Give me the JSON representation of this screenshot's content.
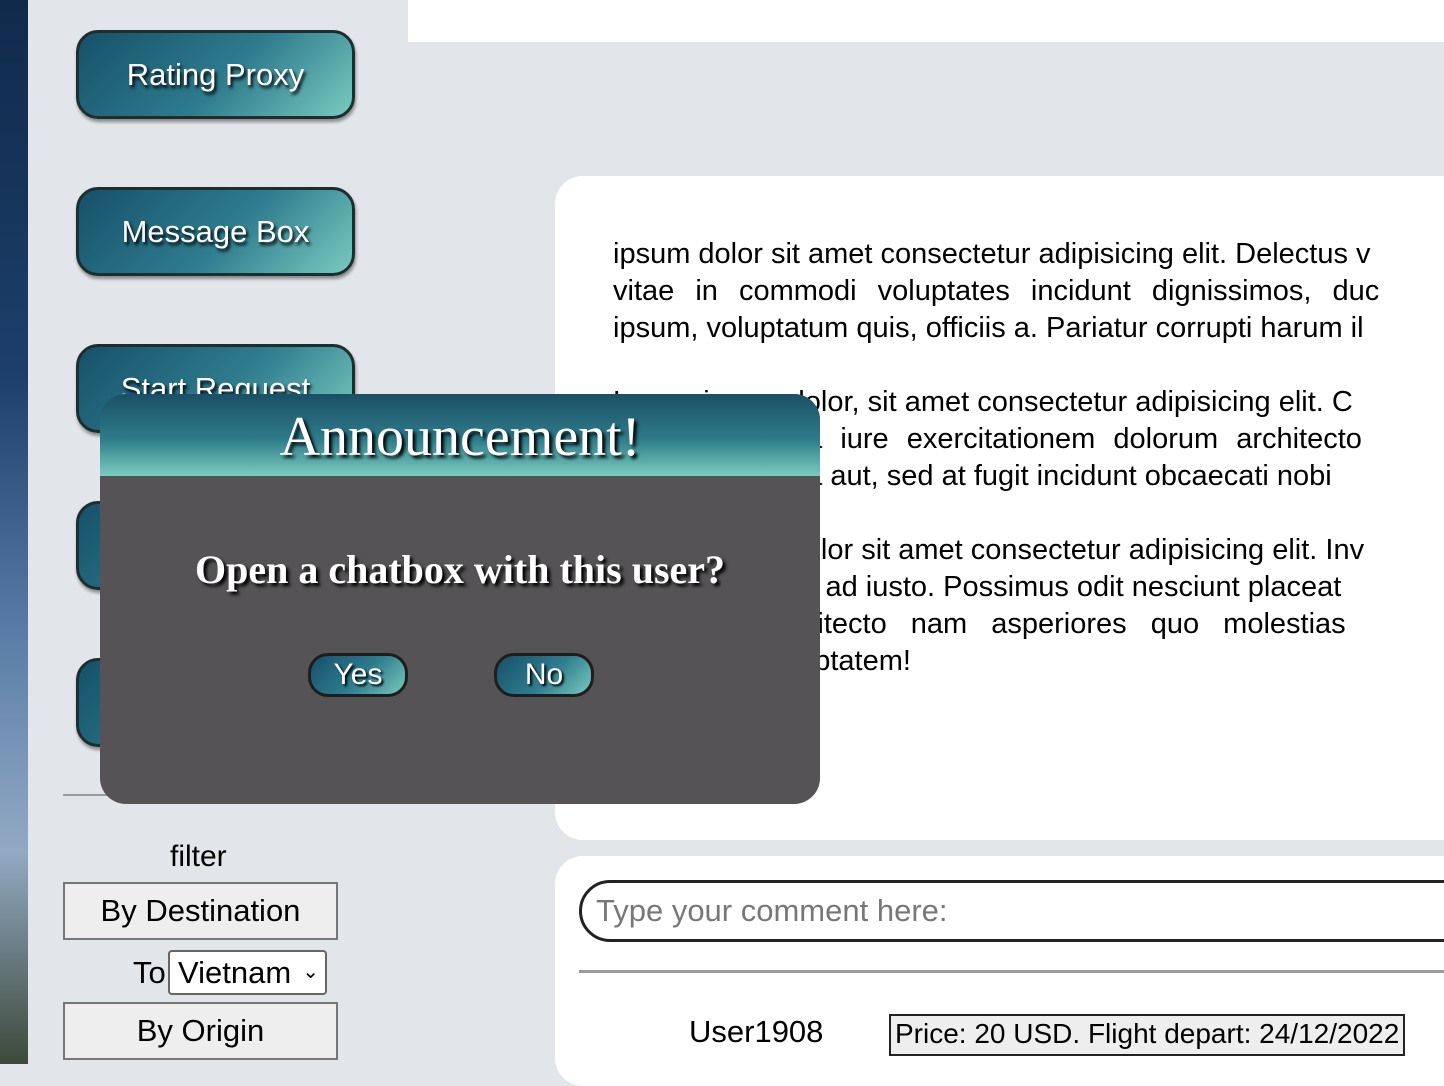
{
  "sidebar": {
    "nav_buttons": [
      {
        "label": "Rating Proxy"
      },
      {
        "label": "Message Box"
      },
      {
        "label": "Start Request"
      },
      {
        "label": ""
      },
      {
        "label": ""
      }
    ],
    "filter": {
      "label": "filter",
      "by_destination": "By Destination",
      "to_label": "To",
      "to_value": "Vietnam",
      "by_origin": "By Origin"
    }
  },
  "article": {
    "paragraphs": [
      [
        "ipsum dolor sit amet consectetur adipisicing elit. Delectus v",
        "vitae in commodi voluptates incidunt dignissimos, duc",
        "ipsum, voluptatum quis, officiis a. Pariatur corrupti harum il"
      ],
      [
        "Lorem ipsum dolor, sit amet consectetur adipisicing elit. C",
        "dicta iure exercitationem dolorum architecto",
        "nulla aut, sed at fugit incidunt obcaecati nobi"
      ],
      [
        "Lorem ipsum dolor sit amet consectetur adipisicing elit. Inv",
        "num ad iusto. Possimus odit nesciunt placeat",
        "architecto nam asperiores quo molestias",
        "voluptatem!"
      ]
    ]
  },
  "comments": {
    "input_placeholder": "Type your comment here:",
    "entries": [
      {
        "user": "User1908",
        "text": "Price: 20 USD. Flight depart: 24/12/2022"
      }
    ]
  },
  "modal": {
    "title": "Announcement!",
    "question": "Open a chatbox with this user?",
    "yes_label": "Yes",
    "no_label": "No"
  },
  "colors": {
    "button_gradient_dark": "#16516a",
    "button_gradient_light": "#79cabf",
    "modal_bg": "#555355",
    "page_bg": "#e2e5e9"
  }
}
